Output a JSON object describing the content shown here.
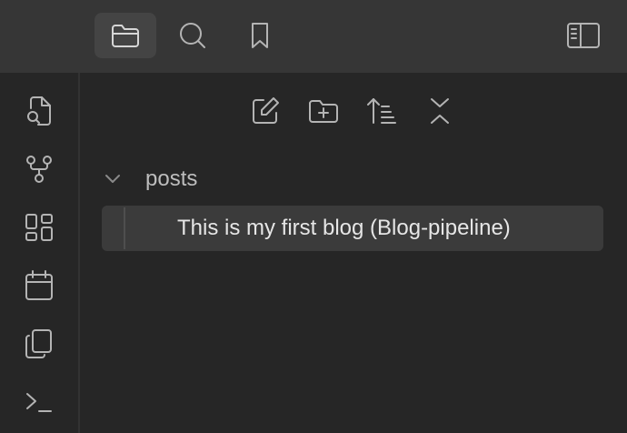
{
  "topbar": {
    "tabs": [
      {
        "name": "Files",
        "icon": "folder-icon",
        "active": true
      },
      {
        "name": "Search",
        "icon": "search-icon",
        "active": false
      },
      {
        "name": "Bookmarks",
        "icon": "bookmark-icon",
        "active": false
      }
    ],
    "right_icon": "sidebar-toggle-icon"
  },
  "ribbon": {
    "items": [
      {
        "icon": "quick-switcher-icon"
      },
      {
        "icon": "graph-view-icon"
      },
      {
        "icon": "canvas-icon"
      },
      {
        "icon": "daily-note-icon"
      },
      {
        "icon": "templates-icon"
      },
      {
        "icon": "command-palette-icon"
      }
    ]
  },
  "explorer": {
    "toolbar": [
      {
        "icon": "new-note-icon"
      },
      {
        "icon": "new-folder-icon"
      },
      {
        "icon": "sort-icon"
      },
      {
        "icon": "collapse-all-icon"
      }
    ],
    "folder": {
      "label": "posts",
      "expanded": true,
      "files": [
        {
          "label": "This is my first blog (Blog-pipeline)",
          "selected": true
        }
      ]
    }
  },
  "colors": {
    "header_bg": "#363636",
    "pane_bg": "#262626",
    "selected_bg": "#3b3b3b",
    "icon": "#b4b4b4",
    "text": "#e6e6e6"
  }
}
